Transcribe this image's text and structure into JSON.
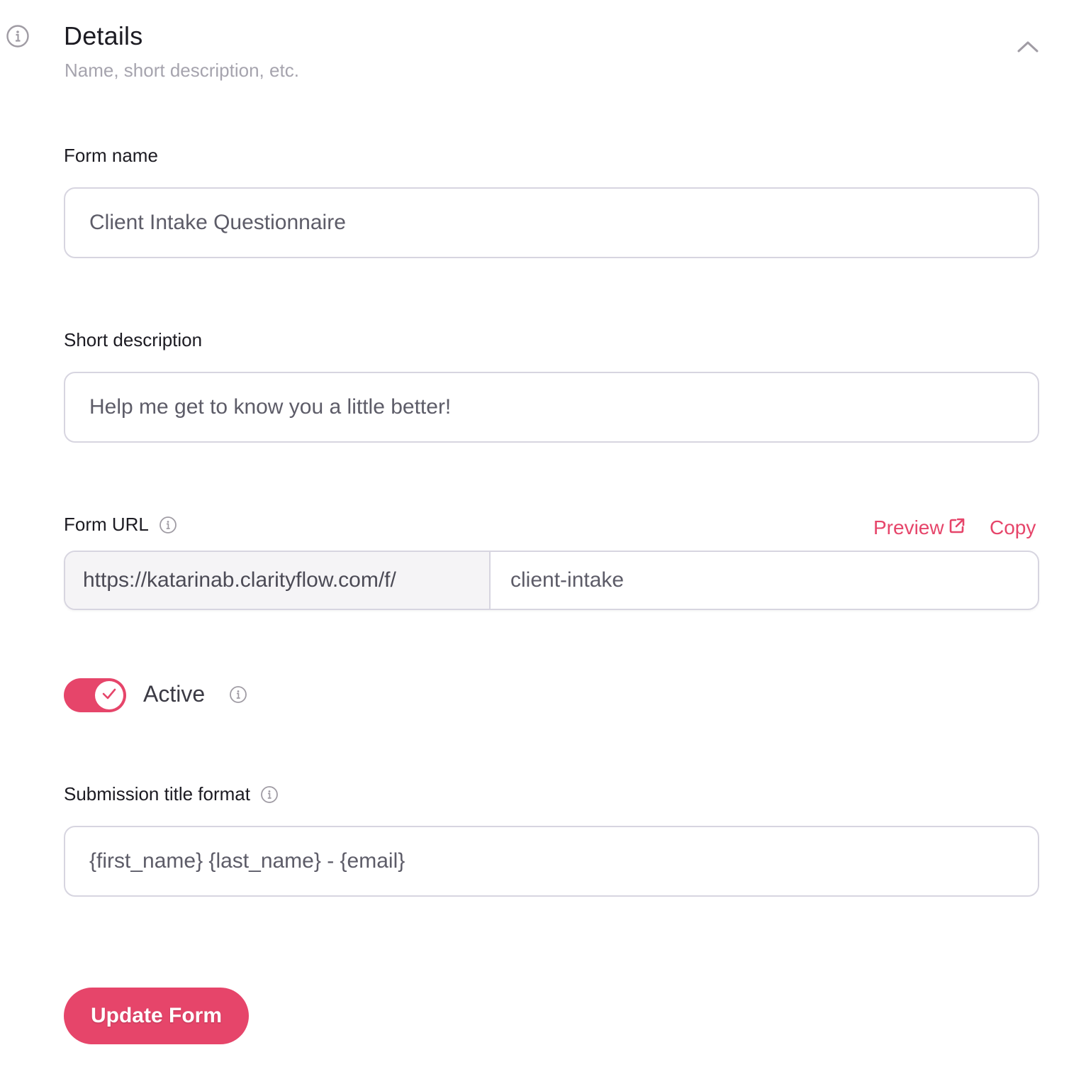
{
  "section": {
    "icon": "info-circle-icon",
    "title": "Details",
    "subtitle": "Name, short description, etc.",
    "collapse_icon": "chevron-up-icon"
  },
  "fields": {
    "form_name": {
      "label": "Form name",
      "value": "Client Intake Questionnaire"
    },
    "short_description": {
      "label": "Short description",
      "value": "Help me get to know you a little better!"
    },
    "form_url": {
      "label": "Form URL",
      "info_icon": "info-circle-icon",
      "prefix": "https://katarinab.clarityflow.com/f/",
      "slug": "client-intake",
      "preview_label": "Preview",
      "preview_icon": "external-link-icon",
      "copy_label": "Copy"
    },
    "active": {
      "label": "Active",
      "checked": true,
      "info_icon": "info-circle-icon"
    },
    "submission_title_format": {
      "label": "Submission title format",
      "info_icon": "info-circle-icon",
      "value": "{first_name} {last_name} - {email}"
    }
  },
  "actions": {
    "submit_label": "Update Form"
  },
  "colors": {
    "accent": "#e6456a",
    "border": "#d7d5e0",
    "muted_text": "#a6a4ae",
    "input_text": "#5d5c68"
  }
}
